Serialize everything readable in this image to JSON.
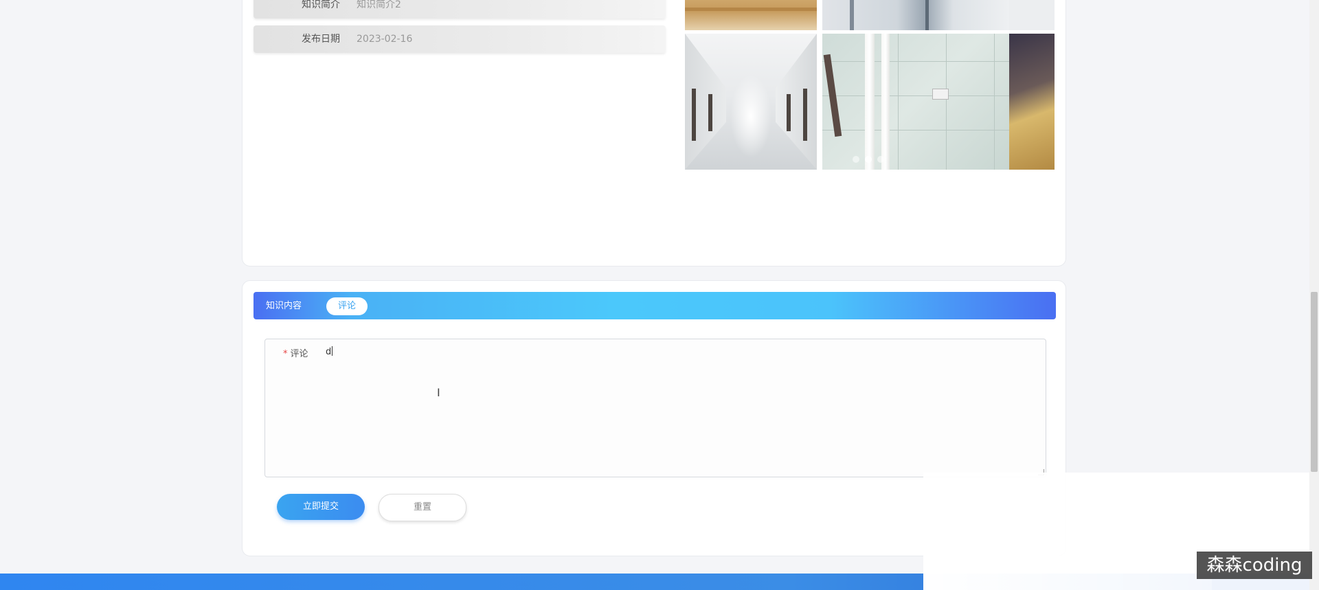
{
  "info": {
    "intro_label": "知识简介",
    "intro_value": "知识简介2",
    "date_label": "发布日期",
    "date_value": "2023-02-16"
  },
  "gallery": {
    "slide_count": 3,
    "active_slide": 2
  },
  "tabs": {
    "knowledge": "知识内容",
    "comment": "评论"
  },
  "comment_form": {
    "required_mark": "*",
    "label": "评论",
    "value": "d",
    "submit_label": "立即提交",
    "reset_label": "重置"
  },
  "watermark": "森森coding",
  "colors": {
    "accent": "#3aa4f0",
    "tab_gradient_start": "#4a6ff2",
    "tab_gradient_mid": "#4bc8fb",
    "footer": "#2f86f0"
  }
}
